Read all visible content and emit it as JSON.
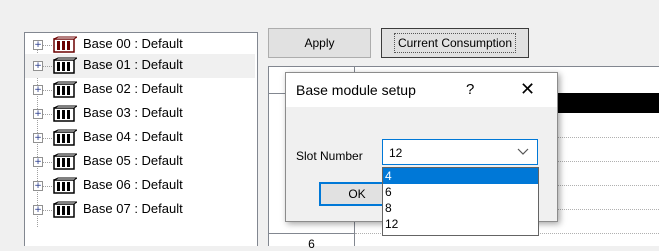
{
  "tree": {
    "items": [
      {
        "label": "Base 00 : Default",
        "expander": "+"
      },
      {
        "label": "Base 01 : Default",
        "expander": "+"
      },
      {
        "label": "Base 02 : Default",
        "expander": "+"
      },
      {
        "label": "Base 03 : Default",
        "expander": "+"
      },
      {
        "label": "Base 04 : Default",
        "expander": "+"
      },
      {
        "label": "Base 05 : Default",
        "expander": "+"
      },
      {
        "label": "Base 06 : Default",
        "expander": "+"
      },
      {
        "label": "Base 07 : Default",
        "expander": "+"
      }
    ],
    "icon": "base-rack-icon",
    "icon_color": "#6b0000"
  },
  "toolbar": {
    "apply_label": "Apply",
    "consumption_label": "Current Consumption"
  },
  "grid": {
    "visible_slot_cell": "6",
    "selection_color": "#000000"
  },
  "dialog": {
    "title": "Base module setup",
    "help_glyph": "?",
    "close_glyph": "✕",
    "slot_label": "Slot Number",
    "slot_value": "12",
    "ok_label": "OK",
    "accent": "#0078d7"
  },
  "slot_options": [
    "4",
    "6",
    "8",
    "12"
  ],
  "slot_highlighted": "4"
}
